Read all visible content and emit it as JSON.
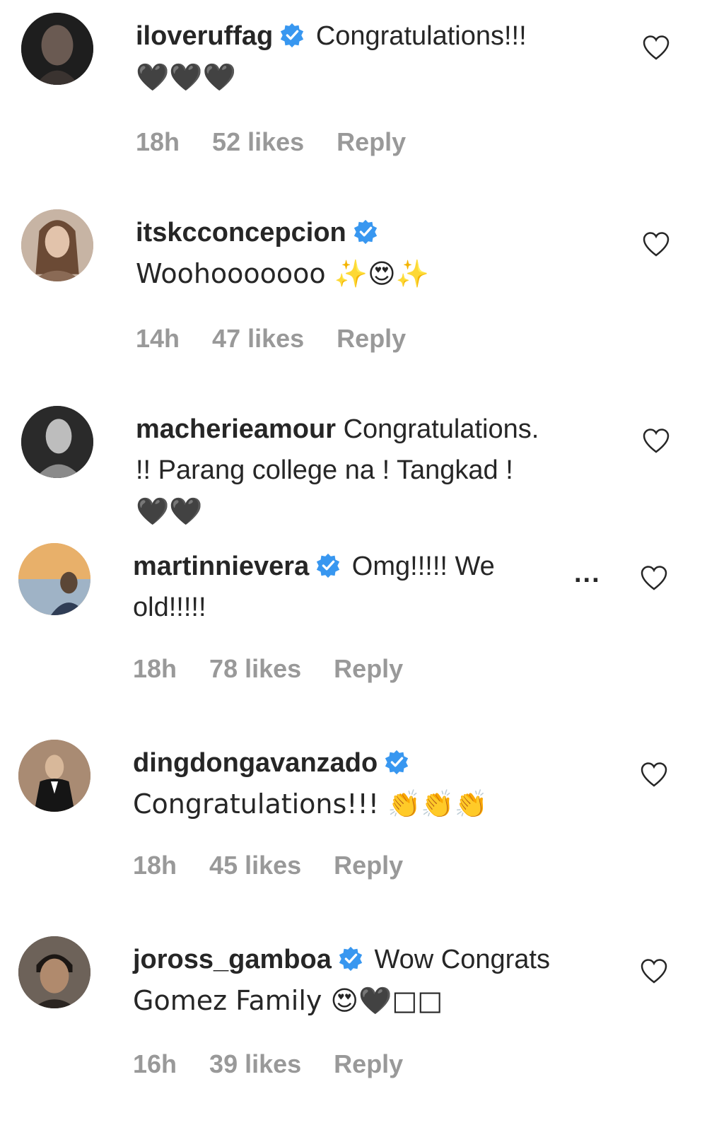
{
  "comments": [
    {
      "username": "iloveruffag",
      "verified": true,
      "text": "Congratulations!!!",
      "text2": "🖤🖤🖤",
      "time": "18h",
      "likes": "52 likes",
      "reply": "Reply"
    },
    {
      "username": "itskcconcepcion",
      "verified": true,
      "text": "Woohooooooo ✨😍✨",
      "time": "14h",
      "likes": "47 likes",
      "reply": "Reply"
    },
    {
      "username": "macherieamour",
      "verified": false,
      "text": "Congratulations.",
      "text2": "!! Parang college na ! Tangkad !",
      "text3": "🖤🖤"
    },
    {
      "username": "martinnievera",
      "verified": true,
      "text": "Omg!!!!! We",
      "text2": "old!!!!!",
      "more": "...",
      "time": "18h",
      "likes": "78 likes",
      "reply": "Reply"
    },
    {
      "username": "dingdongavanzado",
      "verified": true,
      "text": "Congratulations!!! 👏👏👏",
      "time": "18h",
      "likes": "45 likes",
      "reply": "Reply"
    },
    {
      "username": "joross_gamboa",
      "verified": true,
      "text": "Wow Congrats",
      "text2": "Gomez Family 😍🖤□□",
      "time": "16h",
      "likes": "39 likes",
      "reply": "Reply"
    }
  ],
  "colors": {
    "verified_blue": "#3897f0",
    "meta_gray": "#999999",
    "text": "#262626"
  },
  "icons": {
    "like": "heart-outline-icon",
    "verified": "verified-badge-icon",
    "more": "more-options-icon"
  }
}
